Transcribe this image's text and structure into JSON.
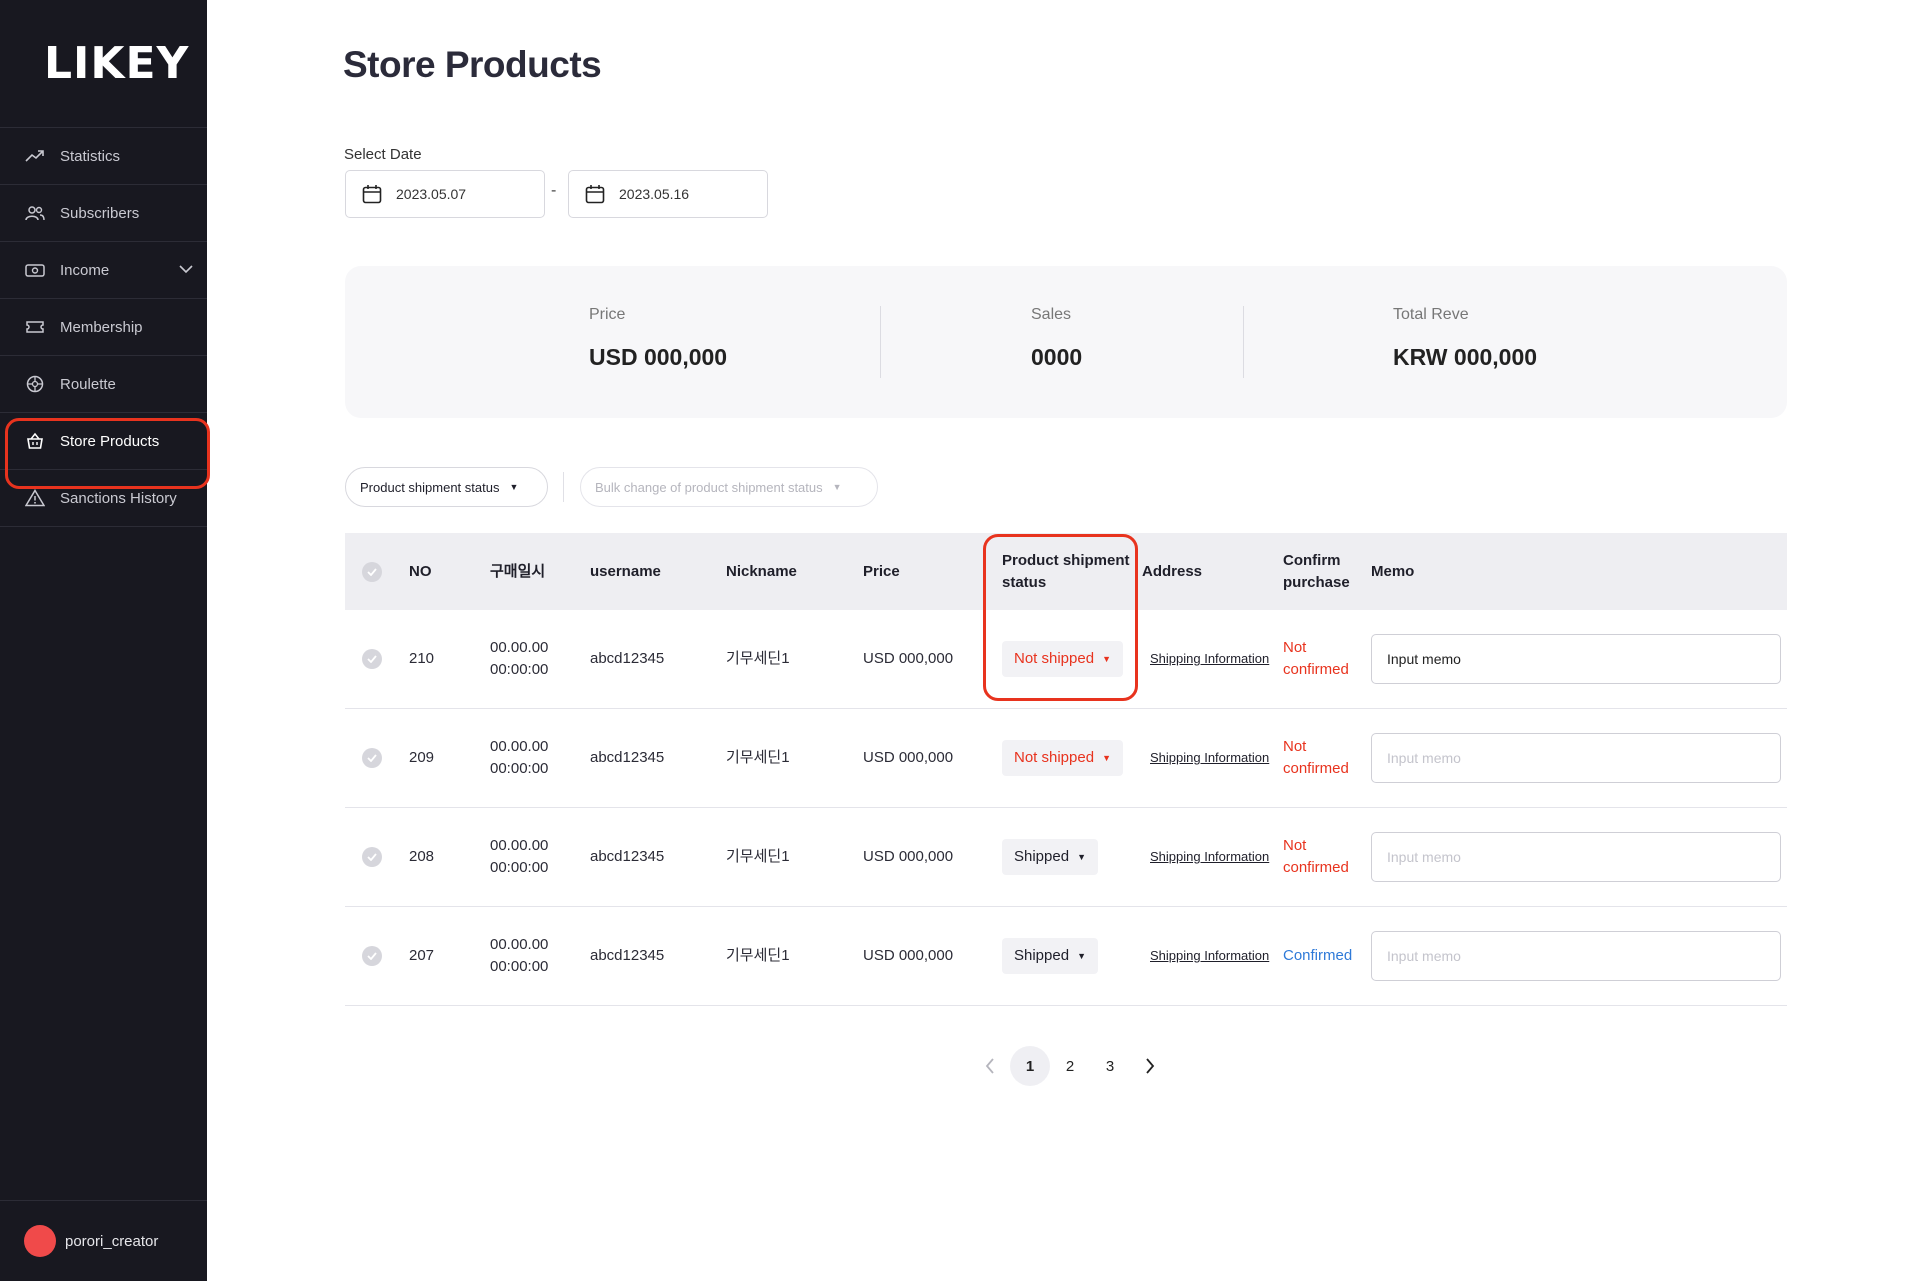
{
  "app": {
    "logo": "LIKEY"
  },
  "sidebar": {
    "items": [
      {
        "label": "Statistics",
        "icon": "trend-icon"
      },
      {
        "label": "Subscribers",
        "icon": "users-icon"
      },
      {
        "label": "Income",
        "icon": "money-icon",
        "expandable": true
      },
      {
        "label": "Membership",
        "icon": "ticket-icon"
      },
      {
        "label": "Roulette",
        "icon": "roulette-icon"
      },
      {
        "label": "Store Products",
        "icon": "basket-icon",
        "active": true
      },
      {
        "label": "Sanctions History",
        "icon": "warning-icon"
      }
    ],
    "user": {
      "name": "porori_creator"
    }
  },
  "header": {
    "title": "Store Products"
  },
  "date_filter": {
    "label": "Select Date",
    "start": "2023.05.07",
    "separator": "-",
    "end": "2023.05.16"
  },
  "summary": [
    {
      "label": "Price",
      "value": "USD 000,000"
    },
    {
      "label": "Sales",
      "value": "0000"
    },
    {
      "label": "Total Reve",
      "value": "KRW 000,000"
    }
  ],
  "filters": {
    "status_filter": "Product shipment status",
    "bulk_change": "Bulk change of product shipment status"
  },
  "table": {
    "headers": {
      "no": "NO",
      "date": "구매일시",
      "username": "username",
      "nickname": "Nickname",
      "price": "Price",
      "status": "Product shipment status",
      "address": "Address",
      "confirm": "Confirm purchase",
      "memo": "Memo"
    },
    "rows": [
      {
        "no": "210",
        "date": "00.00.00",
        "time": "00:00:00",
        "username": "abcd12345",
        "nickname": "기무세딘1",
        "price": "USD 000,000",
        "status": "Not shipped",
        "address": "Shipping Information",
        "confirm_1": "Not",
        "confirm_2": "confirmed",
        "memo_value": "",
        "memo_placeholder": "Input memo"
      },
      {
        "no": "209",
        "date": "00.00.00",
        "time": "00:00:00",
        "username": "abcd12345",
        "nickname": "기무세딘1",
        "price": "USD 000,000",
        "status": "Not shipped",
        "address": "Shipping Information",
        "confirm_1": "Not",
        "confirm_2": "confirmed",
        "memo_value": "",
        "memo_placeholder": "Input memo"
      },
      {
        "no": "208",
        "date": "00.00.00",
        "time": "00:00:00",
        "username": "abcd12345",
        "nickname": "기무세딘1",
        "price": "USD 000,000",
        "status": "Shipped",
        "address": "Shipping Information",
        "confirm_1": "Not",
        "confirm_2": "confirmed",
        "memo_value": "",
        "memo_placeholder": "Input memo"
      },
      {
        "no": "207",
        "date": "00.00.00",
        "time": "00:00:00",
        "username": "abcd12345",
        "nickname": "기무세딘1",
        "price": "USD 000,000",
        "status": "Shipped",
        "address": "Shipping Information",
        "confirm_1": "Confirmed",
        "confirm_2": "",
        "memo_value": "",
        "memo_placeholder": "Input memo"
      }
    ]
  },
  "pagination": {
    "pages": [
      "1",
      "2",
      "3"
    ],
    "current": "1"
  },
  "colors": {
    "sidebar_bg": "#181820",
    "accent_red": "#e8331e",
    "confirmed_blue": "#2f7ad8",
    "avatar": "#f04a4a"
  }
}
